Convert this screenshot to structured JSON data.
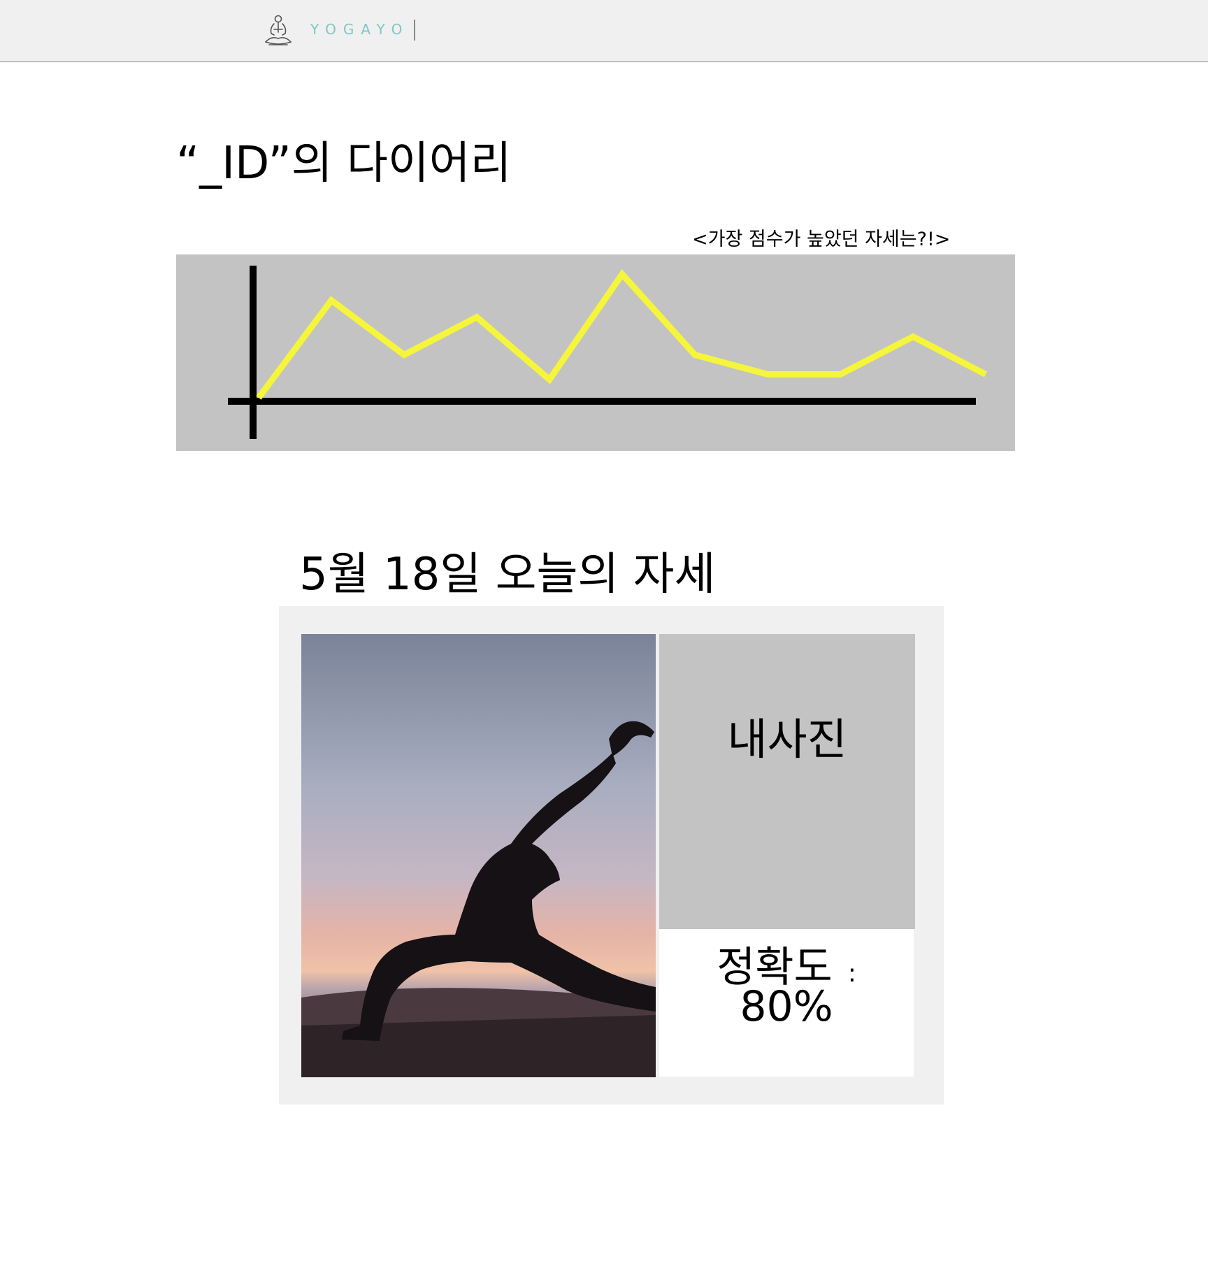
{
  "header": {
    "brand": "YOGAYO"
  },
  "diary": {
    "title": "“_ID”의 다이어리"
  },
  "chart_caption": "<가장 점수가 높았던 자세는?!>",
  "chart_data": {
    "type": "line",
    "title": "",
    "xlabel": "",
    "ylabel": "",
    "x": [
      0,
      1,
      2,
      3,
      4,
      5,
      6,
      7,
      8,
      9,
      10
    ],
    "series": [
      {
        "values": [
          0,
          75,
          33,
          62,
          14,
          95,
          33,
          18,
          18,
          47,
          18
        ]
      }
    ],
    "ylim": [
      0,
      100
    ],
    "grid": false,
    "line_color": "#f5f53c"
  },
  "today": {
    "title": "5월 18일 오늘의 자세",
    "my_photo_label": "내사진",
    "accuracy_label": "정확도",
    "accuracy_colon": ":",
    "accuracy_value": "80%"
  }
}
